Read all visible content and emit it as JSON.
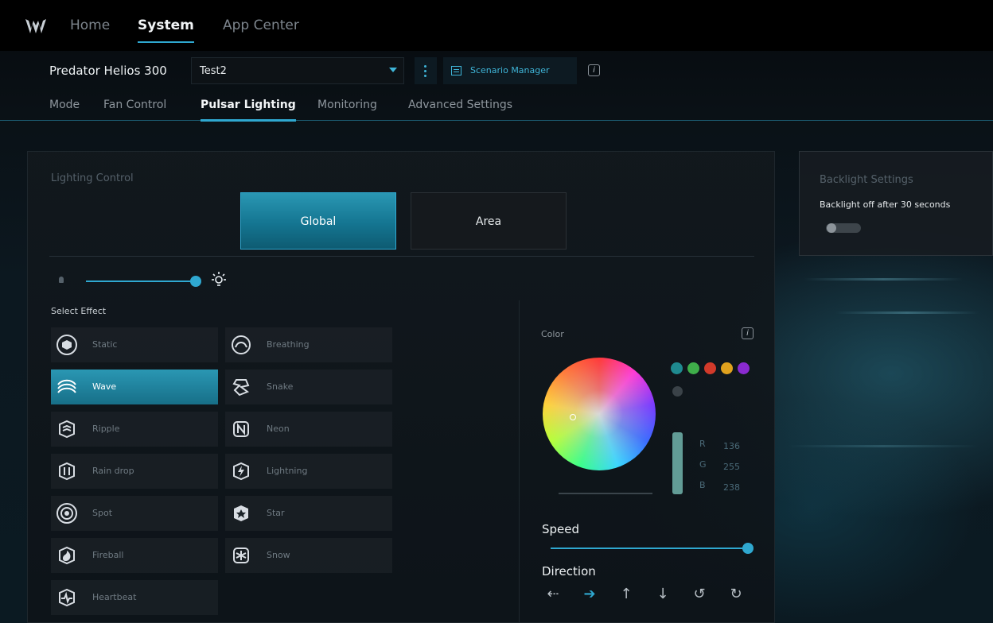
{
  "topnav": {
    "tabs": [
      {
        "label": "Home"
      },
      {
        "label": "System",
        "active": true
      },
      {
        "label": "App Center"
      }
    ]
  },
  "profile": {
    "device_name": "Predator Helios 300",
    "selected_profile": "Test2",
    "scenario_manager_label": "Scenario Manager",
    "info_glyph": "i"
  },
  "subtabs": [
    {
      "label": "Mode"
    },
    {
      "label": "Fan Control"
    },
    {
      "label": "Pulsar Lighting",
      "active": true
    },
    {
      "label": "Monitoring"
    },
    {
      "label": "Advanced Settings"
    }
  ],
  "lighting": {
    "title": "Lighting Control",
    "scope_buttons": [
      "Global",
      "Area"
    ],
    "selected_scope": "Global",
    "brightness_level": 1.0,
    "select_effect_label": "Select Effect",
    "effects": [
      {
        "label": "Static",
        "icon": "static-icon"
      },
      {
        "label": "Breathing",
        "icon": "breathing-icon"
      },
      {
        "label": "Wave",
        "icon": "wave-icon",
        "selected": true
      },
      {
        "label": "Snake",
        "icon": "snake-icon"
      },
      {
        "label": "Ripple",
        "icon": "ripple-icon"
      },
      {
        "label": "Neon",
        "icon": "neon-icon"
      },
      {
        "label": "Rain drop",
        "icon": "raindrop-icon"
      },
      {
        "label": "Lightning",
        "icon": "lightning-icon"
      },
      {
        "label": "Spot",
        "icon": "spot-icon"
      },
      {
        "label": "Star",
        "icon": "star-icon"
      },
      {
        "label": "Fireball",
        "icon": "fireball-icon"
      },
      {
        "label": "Snow",
        "icon": "snow-icon"
      },
      {
        "label": "Heartbeat",
        "icon": "heartbeat-icon"
      }
    ]
  },
  "color": {
    "title": "Color",
    "info_glyph": "i",
    "swatches": [
      "#1f8a90",
      "#3fae4a",
      "#d23a2a",
      "#e0a21e",
      "#8a2ad0"
    ],
    "rgb": {
      "r_label": "R",
      "g_label": "G",
      "b_label": "B",
      "r": "136",
      "g": "255",
      "b": "238"
    },
    "speed_label": "Speed",
    "speed_level": 1.0,
    "direction_label": "Direction",
    "directions": [
      {
        "icon": "arrow-left-icon",
        "glyph": "⇠"
      },
      {
        "icon": "arrow-right-icon",
        "glyph": "➔",
        "active": true
      },
      {
        "icon": "arrow-up-icon",
        "glyph": "↑"
      },
      {
        "icon": "arrow-down-icon",
        "glyph": "↓"
      },
      {
        "icon": "rotate-ccw-icon",
        "glyph": "↺"
      },
      {
        "icon": "rotate-cw-icon",
        "glyph": "↻"
      }
    ]
  },
  "backlight": {
    "title": "Backlight Settings",
    "option_label": "Backlight off after 30 seconds",
    "enabled": false
  },
  "colors": {
    "accent": "#2fa8d0",
    "background": "#05080c"
  }
}
